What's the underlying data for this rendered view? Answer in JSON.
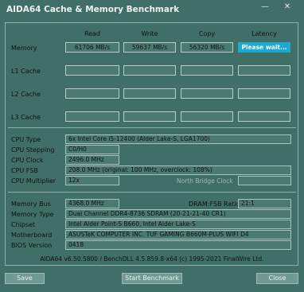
{
  "window": {
    "title": "AIDA64 Cache & Memory Benchmark"
  },
  "columns": [
    "Read",
    "Write",
    "Copy",
    "Latency"
  ],
  "rows": {
    "memory": {
      "label": "Memory",
      "read": "61706 MB/s",
      "write": "59637 MB/s",
      "copy": "56320 MB/s",
      "latency": "Please wait..."
    },
    "l1": {
      "label": "L1 Cache"
    },
    "l2": {
      "label": "L2 Cache"
    },
    "l3": {
      "label": "L3 Cache"
    }
  },
  "cpu": {
    "type_label": "CPU Type",
    "type": "6x Intel Core i5-12400  (Alder Lake-S, LGA1700)",
    "stepping_label": "CPU Stepping",
    "stepping": "C0/H0",
    "clock_label": "CPU Clock",
    "clock": "2496.0 MHz",
    "fsb_label": "CPU FSB",
    "fsb": "208.0 MHz  (original: 100 MHz, overclock: 108%)",
    "multiplier_label": "CPU Multiplier",
    "multiplier": "12x",
    "nb_clock_label": "North Bridge Clock"
  },
  "memory_info": {
    "bus_label": "Memory Bus",
    "bus": "4368.0 MHz",
    "ratio_label": "DRAM:FSB Ratio",
    "ratio": "21:1",
    "type_label": "Memory Type",
    "type": "Dual Channel DDR4-8736 SDRAM  (20-21-21-40 CR1)",
    "chipset_label": "Chipset",
    "chipset": "Intel Alder Point-S B660, Intel Alder Lake-S",
    "motherboard_label": "Motherboard",
    "motherboard": "ASUSTeK COMPUTER INC. TUF GAMING B660M-PLUS WIFI D4",
    "bios_label": "BIOS Version",
    "bios": "0418"
  },
  "footer": "AIDA64 v6.50.5800 / BenchDLL 4.5.859.8-x64  (c) 1995-2021 FinalWire Ltd.",
  "buttons": {
    "save": "Save",
    "start": "Start Benchmark",
    "close": "Close"
  },
  "icons": {
    "minimize": "minimize-icon",
    "close": "close-icon"
  }
}
